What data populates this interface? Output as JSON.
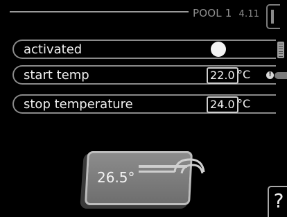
{
  "header": {
    "title": "POOL 1",
    "menu_number": "4.11"
  },
  "settings": {
    "activated": {
      "label": "activated",
      "state": "on"
    },
    "start_temp": {
      "label": "start temp",
      "value": "22.0",
      "unit": "°C"
    },
    "stop_temperature": {
      "label": "stop temperature",
      "value": "24.0",
      "unit": "°C"
    }
  },
  "pool": {
    "temperature": "26.5°"
  },
  "help": {
    "label": "?"
  }
}
